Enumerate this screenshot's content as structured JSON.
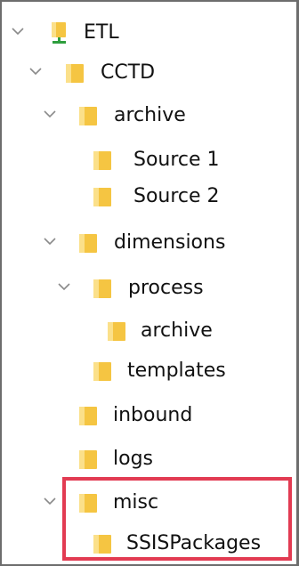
{
  "tree": {
    "root": {
      "label": "ETL",
      "icon": "network-folder-icon",
      "expanded": true
    },
    "items": [
      {
        "key": "cctd",
        "label": "CCTD",
        "expanded": true
      },
      {
        "key": "archive",
        "label": "archive",
        "expanded": true
      },
      {
        "key": "source1",
        "label": "Source 1"
      },
      {
        "key": "source2",
        "label": "Source 2"
      },
      {
        "key": "dimensions",
        "label": "dimensions",
        "expanded": true
      },
      {
        "key": "process",
        "label": "process",
        "expanded": true
      },
      {
        "key": "process-archive",
        "label": "archive"
      },
      {
        "key": "templates",
        "label": "templates"
      },
      {
        "key": "inbound",
        "label": "inbound"
      },
      {
        "key": "logs",
        "label": "logs"
      },
      {
        "key": "misc",
        "label": "misc",
        "expanded": true
      },
      {
        "key": "ssispackages",
        "label": "SSISPackages"
      }
    ]
  },
  "colors": {
    "folder": "#f5c542",
    "folder_light": "#fbe08a",
    "highlight": "#e23b52",
    "network_base": "#2e9e3e"
  }
}
